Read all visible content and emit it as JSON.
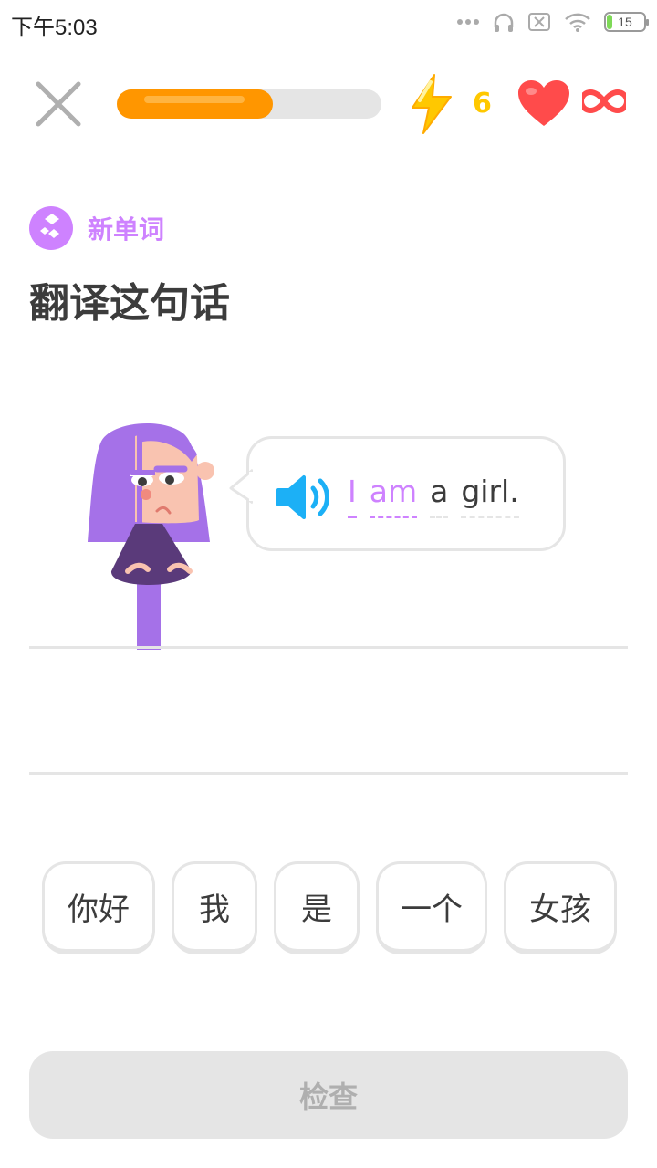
{
  "status_bar": {
    "time": "下午5:03",
    "battery": "15",
    "icons": [
      "dots-icon",
      "headphones-icon",
      "sim-off-icon",
      "wifi-icon",
      "battery-icon"
    ]
  },
  "top_bar": {
    "close_icon": "close-icon",
    "progress": 0.59,
    "progress_color": "#ff9600",
    "streak_icon": "lightning-icon",
    "streak_count": "6",
    "streak_color": "#ffc800",
    "heart_icon": "heart-icon",
    "heart_color": "#ff4b4b",
    "hearts_icon": "infinity-icon"
  },
  "header": {
    "badge_label": "新单词",
    "badge_color": "#ce82ff",
    "title": "翻译这句话"
  },
  "prompt": {
    "speaker_icon": "speaker-icon",
    "words": [
      {
        "text": "I",
        "new": true
      },
      {
        "text": "am",
        "new": true
      },
      {
        "text": "a",
        "new": false
      },
      {
        "text": "girl.",
        "new": false
      }
    ]
  },
  "word_bank": [
    {
      "text": "你好"
    },
    {
      "text": "我"
    },
    {
      "text": "是"
    },
    {
      "text": "一个"
    },
    {
      "text": "女孩"
    }
  ],
  "check_button": {
    "label": "检查",
    "enabled": false
  }
}
